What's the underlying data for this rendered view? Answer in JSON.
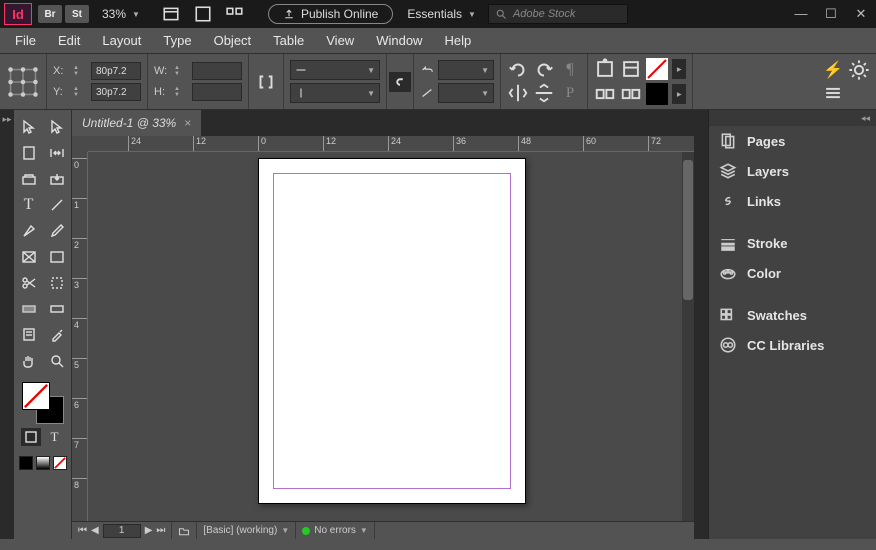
{
  "titlebar": {
    "badges": [
      "Br",
      "St"
    ],
    "zoom": "33%",
    "publish": "Publish Online",
    "workspace": "Essentials",
    "search_placeholder": "Adobe Stock"
  },
  "menu": [
    "File",
    "Edit",
    "Layout",
    "Type",
    "Object",
    "Table",
    "View",
    "Window",
    "Help"
  ],
  "control": {
    "x": "80p7.2",
    "y": "30p7.2",
    "w": "",
    "h": ""
  },
  "document": {
    "tab_title": "Untitled-1 @ 33%",
    "ruler_ticks": [
      "24",
      "12",
      "0",
      "12",
      "24",
      "36",
      "48",
      "60",
      "72"
    ],
    "vticks": [
      "0",
      "1",
      "2",
      "3",
      "4",
      "5",
      "6",
      "7",
      "8"
    ]
  },
  "panels": {
    "group1": [
      "Pages",
      "Layers",
      "Links"
    ],
    "group2": [
      "Stroke",
      "Color"
    ],
    "group3": [
      "Swatches",
      "CC Libraries"
    ]
  },
  "status": {
    "page": "1",
    "preflight": "[Basic] (working)",
    "errors": "No errors"
  }
}
